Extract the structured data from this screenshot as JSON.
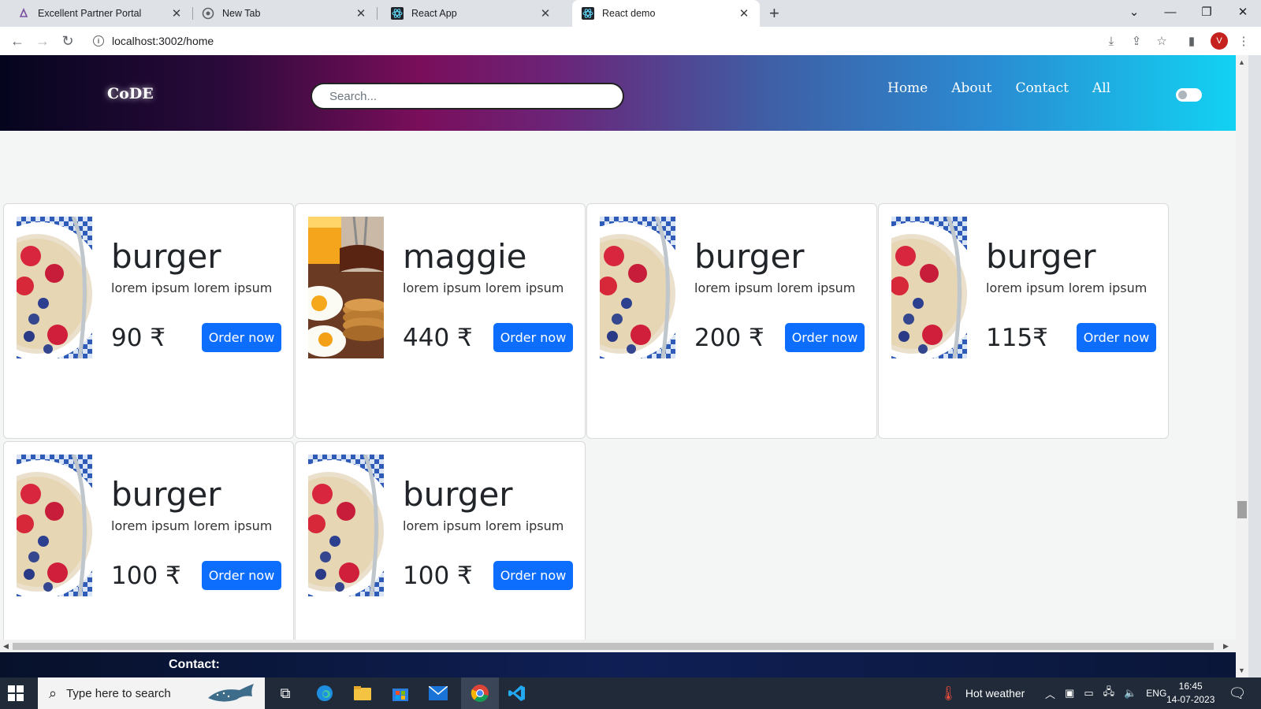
{
  "browser": {
    "tabs": [
      {
        "label": "Excellent Partner Portal",
        "active": false
      },
      {
        "label": "New Tab",
        "active": false
      },
      {
        "label": "React App",
        "active": false
      },
      {
        "label": "React demo",
        "active": true
      }
    ],
    "url": "localhost:3002/home",
    "profile_initial": "V"
  },
  "site": {
    "brand": "CoDE",
    "search_placeholder": "Search...",
    "nav_links": [
      "Home",
      "About",
      "Contact",
      "All"
    ],
    "footer_contact": "Contact:"
  },
  "products": [
    {
      "name": "burger",
      "description": "lorem ipsum lorem ipsum",
      "price": "90 ₹",
      "button": "Order now",
      "image": "oatmeal-berries"
    },
    {
      "name": "maggie",
      "description": "lorem ipsum lorem ipsum",
      "price": "440 ₹",
      "button": "Order now",
      "image": "pancakes-eggs"
    },
    {
      "name": "burger",
      "description": "lorem ipsum lorem ipsum",
      "price": "200 ₹",
      "button": "Order now",
      "image": "oatmeal-berries"
    },
    {
      "name": "burger",
      "description": "lorem ipsum lorem ipsum",
      "price": "115₹",
      "button": "Order now",
      "image": "oatmeal-berries"
    },
    {
      "name": "burger",
      "description": "lorem ipsum lorem ipsum",
      "price": "100 ₹",
      "button": "Order now",
      "image": "oatmeal-berries"
    },
    {
      "name": "burger",
      "description": "lorem ipsum lorem ipsum",
      "price": "100 ₹",
      "button": "Order now",
      "image": "oatmeal-berries"
    }
  ],
  "taskbar": {
    "search_placeholder": "Type here to search",
    "weather": "Hot weather",
    "language": "ENG",
    "time": "16:45",
    "date": "14-07-2023"
  },
  "colors": {
    "button_primary": "#0d6efd",
    "taskbar": "#202a38"
  }
}
